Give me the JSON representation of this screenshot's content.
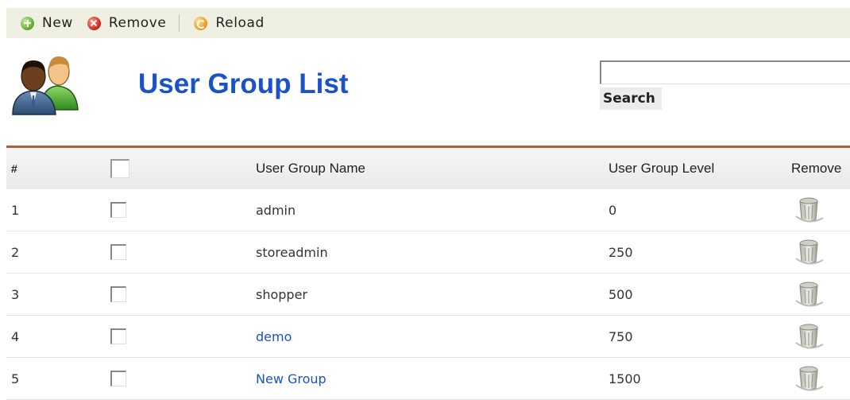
{
  "toolbar": {
    "new_label": "New",
    "remove_label": "Remove",
    "reload_label": "Reload"
  },
  "header": {
    "title": "User Group List"
  },
  "search": {
    "value": "",
    "button_label": "Search"
  },
  "table": {
    "columns": [
      "#",
      "User Group Name",
      "User Group Level",
      "Remove"
    ],
    "rows": [
      {
        "num": "1",
        "name": "admin",
        "level": "0",
        "is_link": false
      },
      {
        "num": "2",
        "name": "storeadmin",
        "level": "250",
        "is_link": false
      },
      {
        "num": "3",
        "name": "shopper",
        "level": "500",
        "is_link": false
      },
      {
        "num": "4",
        "name": "demo",
        "level": "750",
        "is_link": true
      },
      {
        "num": "5",
        "name": "New Group",
        "level": "1500",
        "is_link": true
      }
    ]
  },
  "icons": {
    "new": "plus-circle-icon",
    "remove": "x-circle-icon",
    "reload": "reload-icon",
    "header": "users-icon",
    "row_remove": "trash-icon"
  },
  "colors": {
    "title": "#1a52c8",
    "link": "#1a52c8",
    "toolbar_bg": "#efefe2",
    "table_top_border": "#b85a3c"
  }
}
